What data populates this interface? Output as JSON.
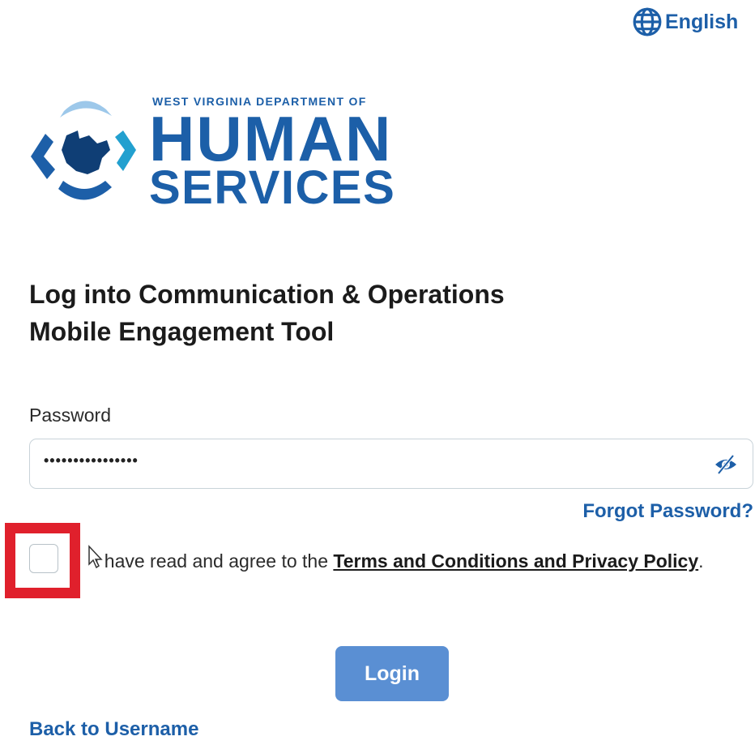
{
  "header": {
    "language_icon": "globe-icon",
    "language_label": "English"
  },
  "logo": {
    "subtitle": "WEST VIRGINIA DEPARTMENT OF",
    "line1": "HUMAN",
    "line2": "SERVICES"
  },
  "title": {
    "line1": "Log into Communication & Operations",
    "line2": "Mobile Engagement Tool"
  },
  "password": {
    "label": "Password",
    "value": "••••••••••••••••",
    "toggle_icon": "eye-slash-icon"
  },
  "forgot_label": "Forgot Password?",
  "agree": {
    "checked": false,
    "text_before": "I have read and agree to the ",
    "link_label": "Terms and Conditions and Privacy Policy",
    "text_after": "."
  },
  "login_label": "Login",
  "back_label": "Back to Username",
  "colors": {
    "brand_blue": "#1d5fa8",
    "button_blue": "#5a8fd3",
    "highlight_red": "#e0202c"
  }
}
